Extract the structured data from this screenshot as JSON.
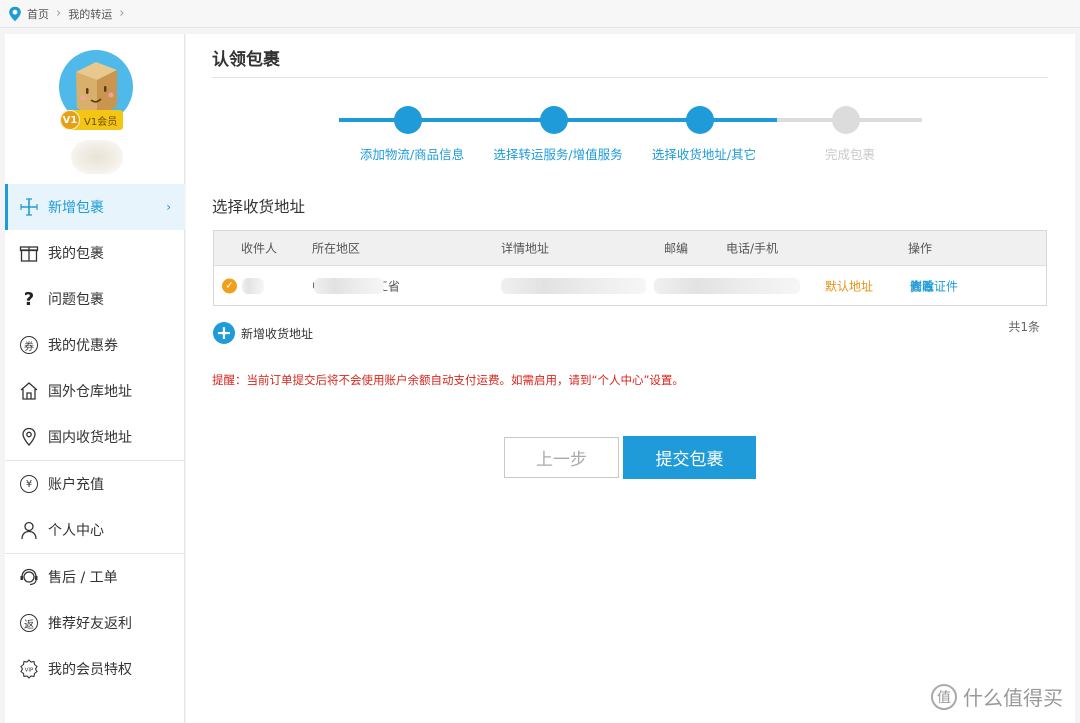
{
  "breadcrumb": {
    "home": "首页",
    "current": "我的转运"
  },
  "user": {
    "badge_level": "V1",
    "badge_text": "V1会员"
  },
  "sidebar": {
    "items": [
      {
        "label": "新增包裹",
        "icon": "plus-icon",
        "active": true
      },
      {
        "label": "我的包裹",
        "icon": "gift-box-icon"
      },
      {
        "label": "问题包裹",
        "icon": "question-icon"
      },
      {
        "label": "我的优惠券",
        "icon": "coupon-icon",
        "glyph": "券"
      },
      {
        "label": "国外仓库地址",
        "icon": "warehouse-icon"
      },
      {
        "label": "国内收货地址",
        "icon": "location-pin-icon"
      },
      {
        "label": "账户充值",
        "icon": "yuan-icon",
        "glyph": "¥"
      },
      {
        "label": "个人中心",
        "icon": "person-icon"
      },
      {
        "label": "售后 / 工单",
        "icon": "headset-icon"
      },
      {
        "label": "推荐好友返利",
        "icon": "rebate-icon",
        "glyph": "返"
      },
      {
        "label": "我的会员特权",
        "icon": "vip-icon"
      }
    ]
  },
  "page": {
    "title": "认领包裹"
  },
  "steps": [
    {
      "label": "添加物流/商品信息",
      "done": true
    },
    {
      "label": "选择转运服务/增值服务",
      "done": true
    },
    {
      "label": "选择收货地址/其它",
      "done": true
    },
    {
      "label": "完成包裹",
      "done": false
    }
  ],
  "address": {
    "section_title": "选择收货地址",
    "columns": [
      "收件人",
      "所在地区",
      "详情地址",
      "邮编",
      "电话/手机",
      "操作"
    ],
    "rows": [
      {
        "region": "中国大陆 浙江省",
        "tag": "默认地址",
        "actions": [
          "查看证件",
          "修改",
          "删除"
        ]
      }
    ],
    "add_label": "新增收货地址",
    "count_label": "共1条"
  },
  "notice": "提醒：当前订单提交后将不会使用账户余额自动支付运费。如需启用，请到“个人中心”设置。",
  "buttons": {
    "prev": "上一步",
    "submit": "提交包裹"
  },
  "watermark": {
    "text": "什么值得买",
    "glyph": "值"
  },
  "colors": {
    "accent": "#1e9bd8",
    "warning": "#d9251c",
    "default_tag": "#e59217"
  }
}
